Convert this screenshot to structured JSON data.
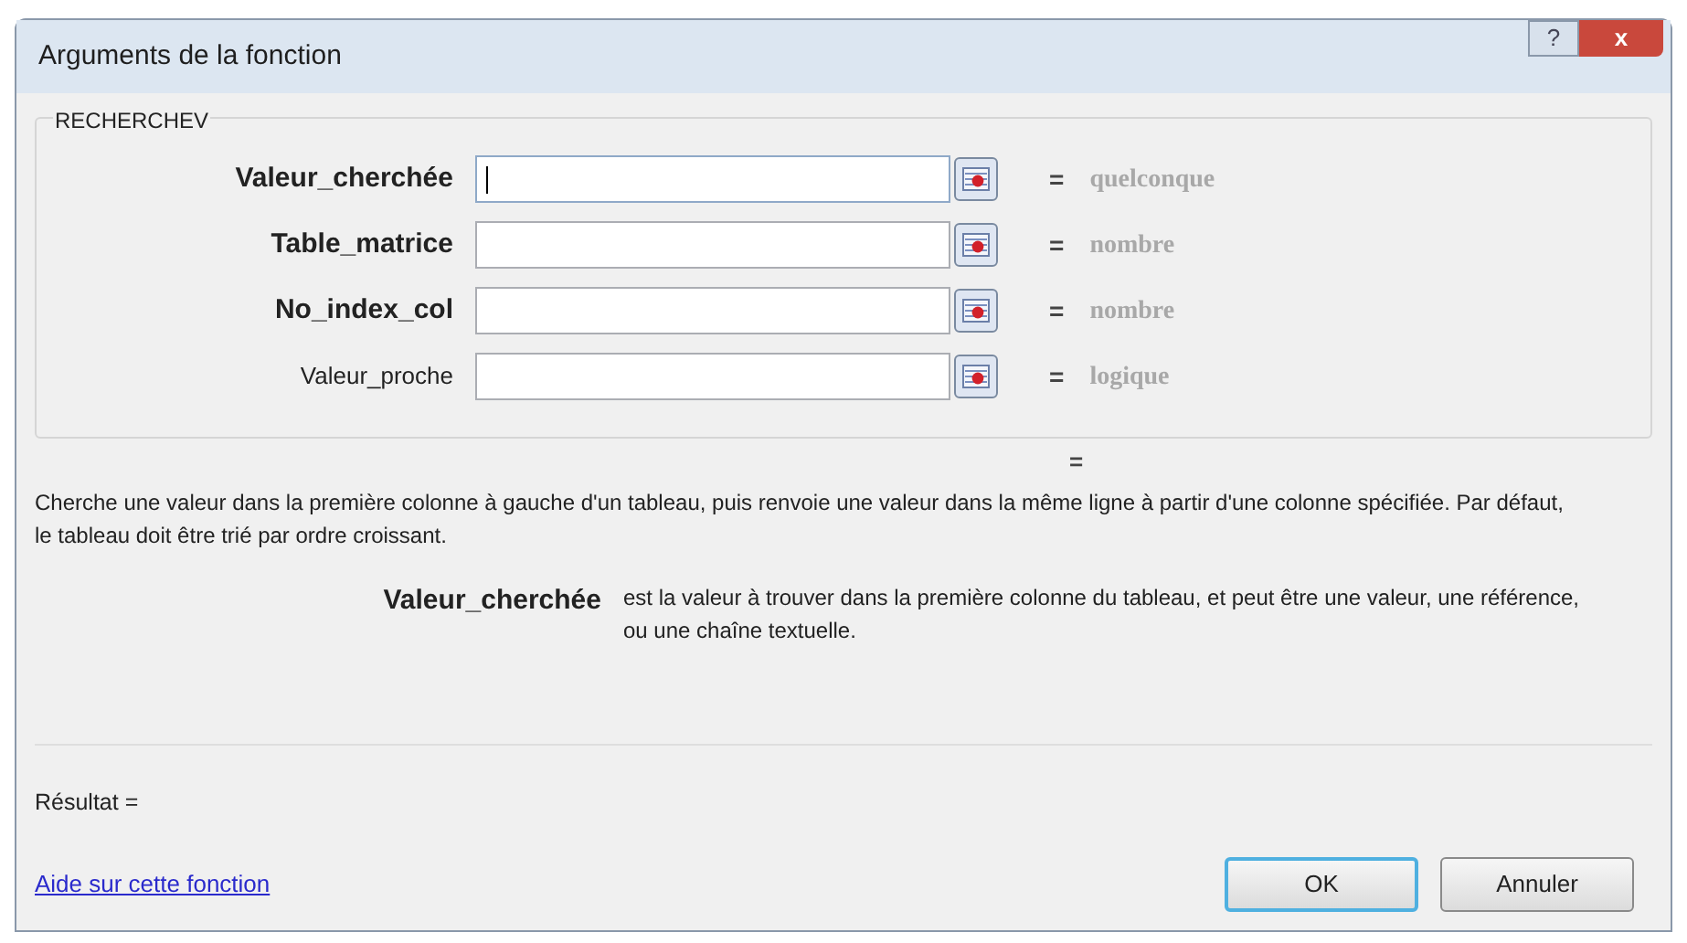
{
  "window": {
    "title": "Arguments de la fonction",
    "buttons": [
      {
        "label": "?",
        "kind": "help"
      },
      {
        "label": "x",
        "kind": "close"
      }
    ]
  },
  "group": {
    "title": "RECHERCHEV",
    "arguments": [
      {
        "name": "Valeur_cherchée",
        "kind": "required",
        "focused": true,
        "result_type": "quelconque"
      },
      {
        "name": "Table_matrice",
        "kind": "required",
        "focused": false,
        "result_type": "nombre"
      },
      {
        "name": "No_index_col",
        "kind": "required",
        "focused": false,
        "result_type": "nombre"
      },
      {
        "name": "Valeur_proche",
        "kind": "optional",
        "focused": false,
        "result_type": "logique"
      }
    ]
  },
  "equals_signs": {
    "argument": "="
  },
  "formula_result": "=",
  "description": "Cherche une valeur dans la première colonne à gauche d'un tableau, puis renvoie une valeur dans la même ligne à partir d'une colonne spécifiée. Par défaut, le tableau doit être trié par ordre croissant.",
  "argument_help": {
    "name": "Valeur_cherchée",
    "text": "est la valeur à trouver dans la première colonne du tableau, et peut être une valeur, une référence, ou une chaîne textuelle."
  },
  "result_label": "Résultat =",
  "help_link": "Aide sur cette fonction",
  "buttons": [
    {
      "label": "OK",
      "kind": "default"
    },
    {
      "label": "Annuler",
      "kind": "normal"
    }
  ]
}
